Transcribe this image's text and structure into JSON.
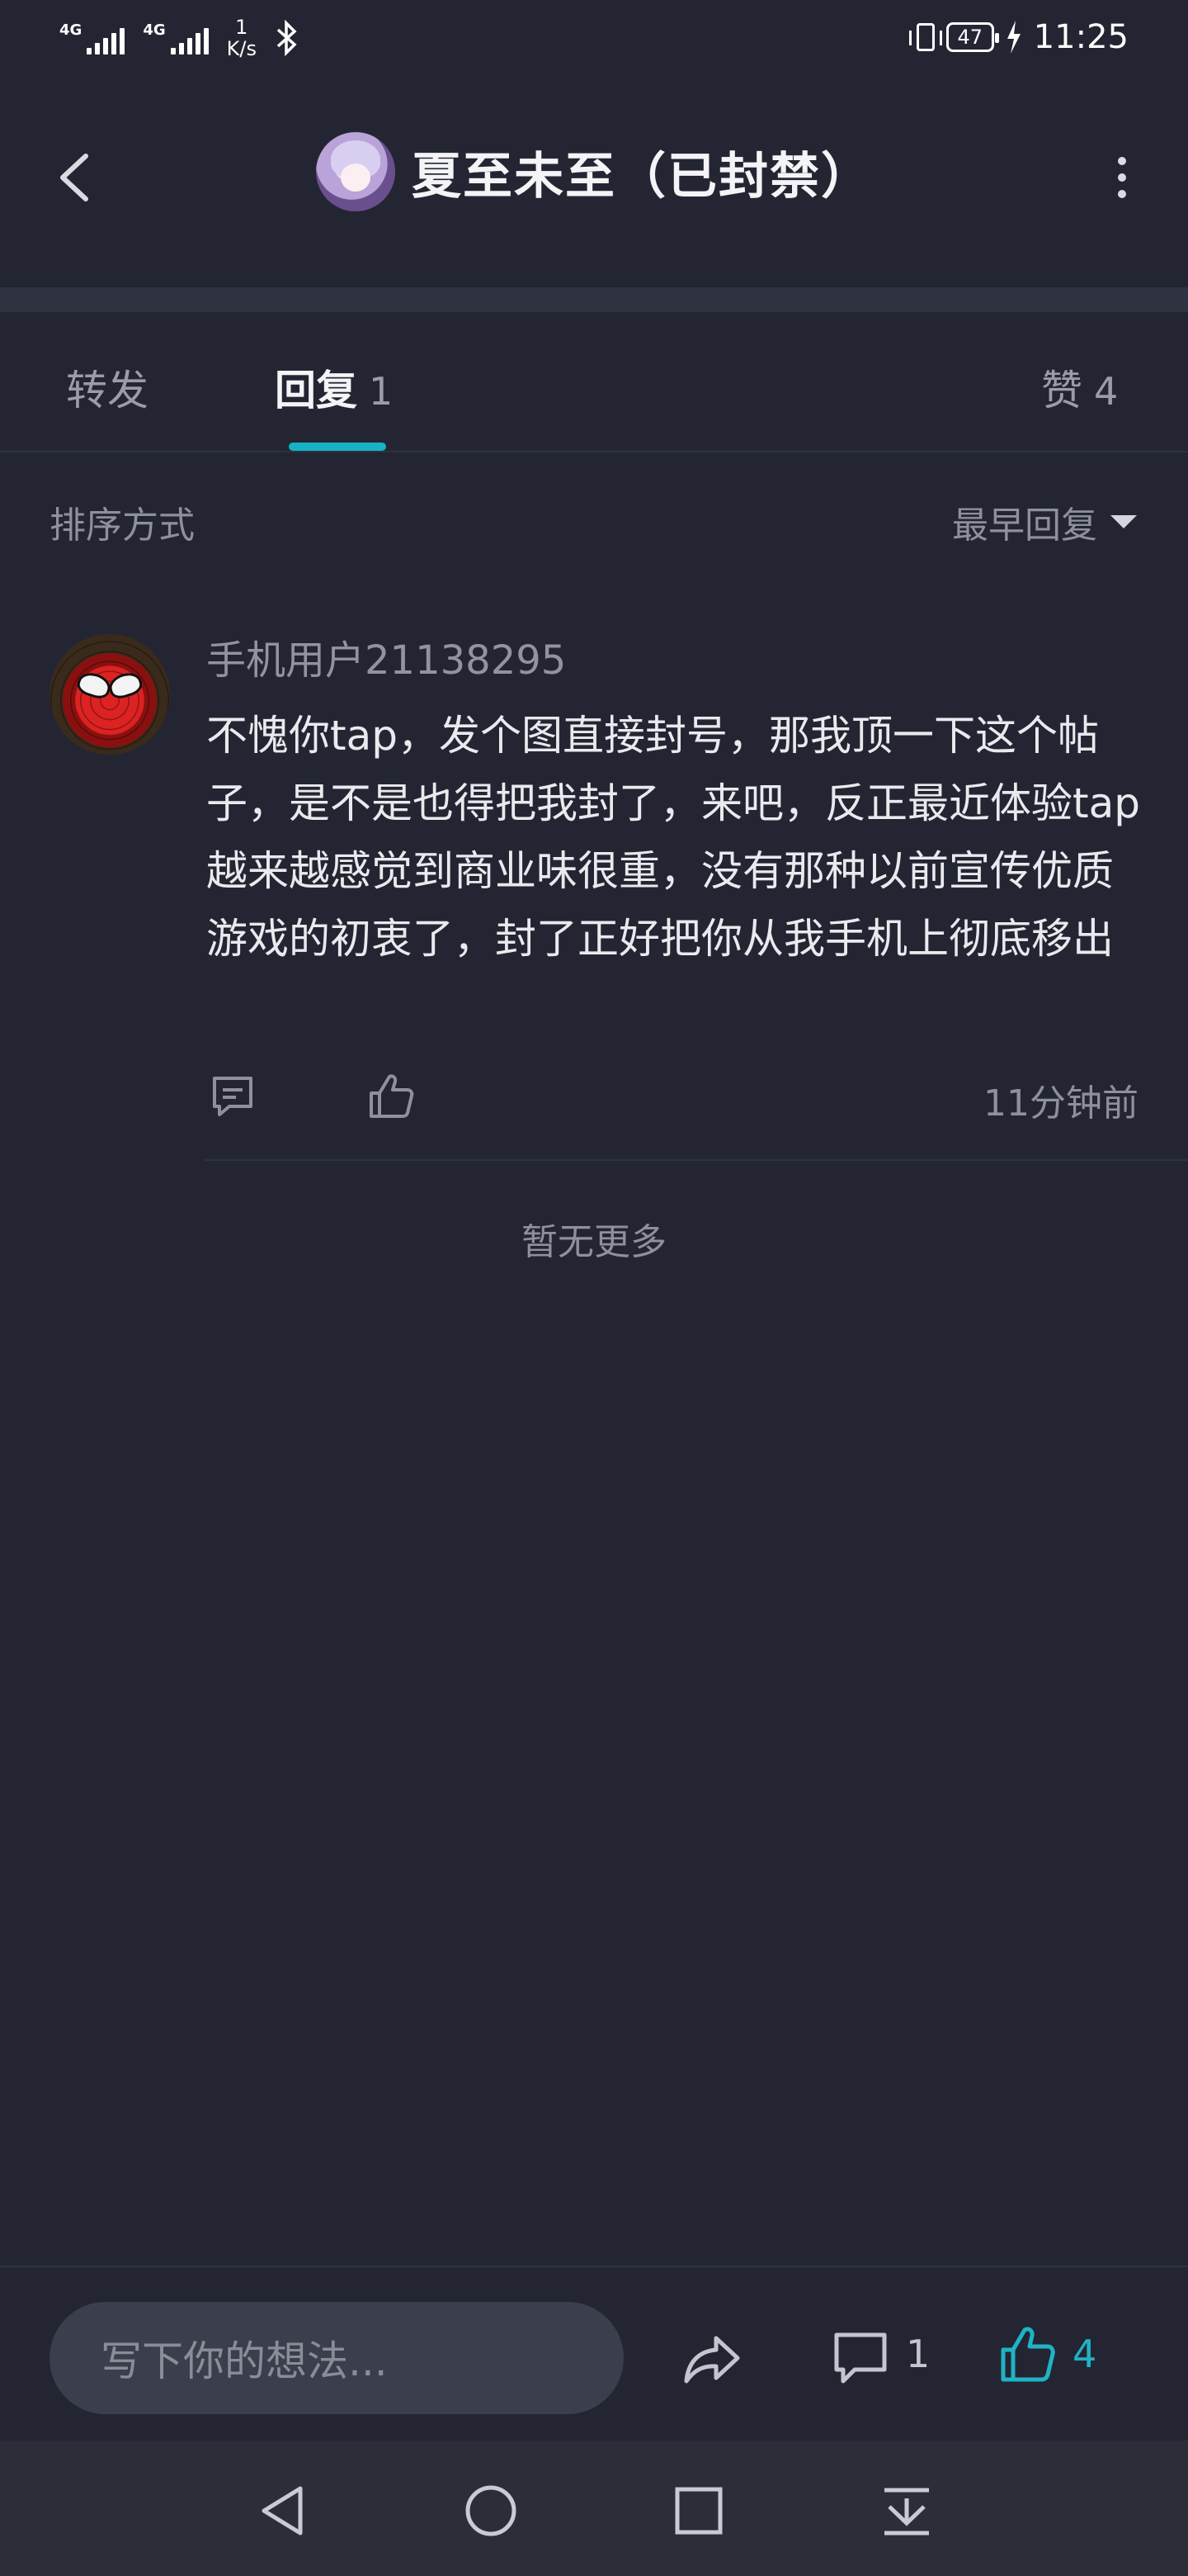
{
  "status_bar": {
    "signal1_label": "4G",
    "signal2_label": "4G",
    "speed_value": "1",
    "speed_unit": "K/s",
    "battery": "47",
    "time": "11:25"
  },
  "header": {
    "title": "夏至未至（已封禁）"
  },
  "tabs": [
    {
      "label": "转发",
      "count": ""
    },
    {
      "label": "回复",
      "count": "1"
    },
    {
      "label": "赞",
      "count": "4"
    }
  ],
  "sort": {
    "label": "排序方式",
    "selected": "最早回复"
  },
  "comment": {
    "username": "手机用户21138295",
    "text": "不愧你tap，发个图直接封号，那我顶一下这个帖子，是不是也得把我封了，来吧，反正最近体验tap越来越感觉到商业味很重，没有那种以前宣传优质游戏的初衷了，封了正好把你从我手机上彻底移出",
    "time": "11分钟前"
  },
  "no_more": "暂无更多",
  "bottom_bar": {
    "input_placeholder": "写下你的想法...",
    "comment_count": "1",
    "like_count": "4"
  },
  "colors": {
    "background": "#232632",
    "accent": "#17b3c4",
    "secondary_text": "#8e909c"
  },
  "icons": [
    "back-icon",
    "more-icon",
    "caret-down-icon",
    "reply-icon",
    "like-icon",
    "share-icon",
    "comment-icon",
    "thumb-up-icon",
    "nav-back-icon",
    "nav-home-icon",
    "nav-recents-icon",
    "nav-dropdown-icon"
  ]
}
